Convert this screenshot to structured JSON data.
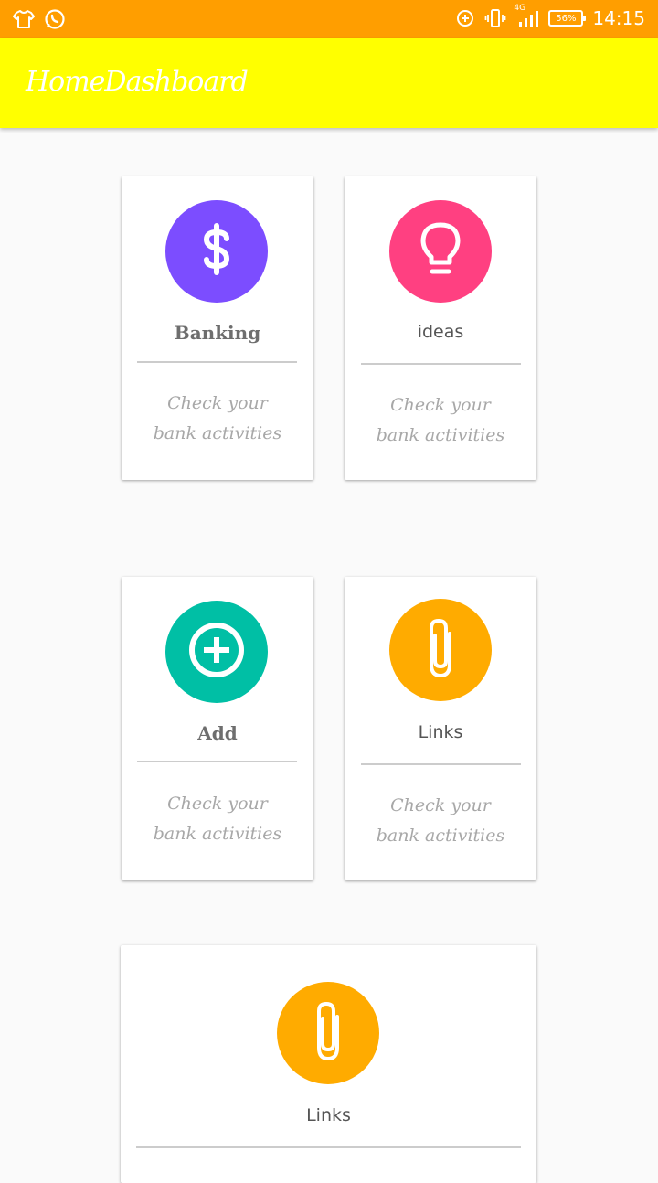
{
  "status_bar": {
    "time": "14:15",
    "battery": "56%",
    "network": "4G",
    "icons": [
      "tshirt-icon",
      "whatsapp-icon",
      "data-saver-icon",
      "vibrate-icon",
      "signal-icon",
      "battery-icon"
    ]
  },
  "app_bar": {
    "title": "HomeDashboard",
    "background": "#ffff00"
  },
  "cards": [
    {
      "title": "Banking",
      "description": "Check your bank activities",
      "icon": "dollar-icon",
      "color": "#7c4dff"
    },
    {
      "title": "ideas",
      "description": "Check your bank activities",
      "icon": "lightbulb-icon",
      "color": "#ff4081"
    },
    {
      "title": "Add",
      "description": "Check your bank activities",
      "icon": "add-circle-icon",
      "color": "#00bfa5"
    },
    {
      "title": "Links",
      "description": "Check your bank activities",
      "icon": "paperclip-icon",
      "color": "#ffab00"
    },
    {
      "title": "Links",
      "icon": "paperclip-icon",
      "color": "#ffab00"
    }
  ]
}
